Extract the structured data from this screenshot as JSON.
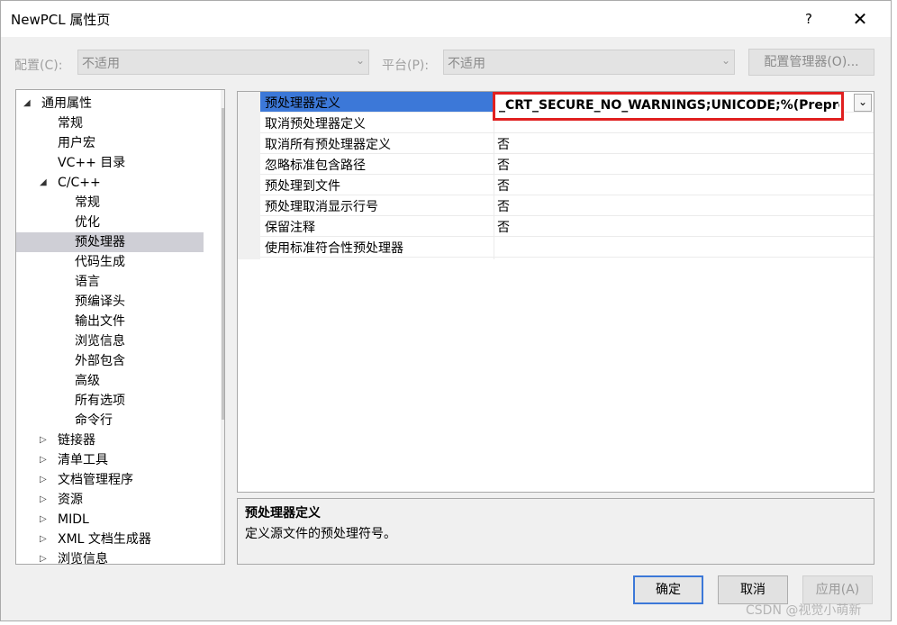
{
  "window": {
    "title": "NewPCL 属性页",
    "help_label": "?",
    "close_label": "✕"
  },
  "toolbar": {
    "config_label": "配置(C):",
    "config_value": "不适用",
    "platform_label": "平台(P):",
    "platform_value": "不适用",
    "manager_button": "配置管理器(O)..."
  },
  "tree": {
    "items": [
      {
        "label": "通用属性",
        "expander": "◢"
      },
      {
        "label": "常规"
      },
      {
        "label": "用户宏"
      },
      {
        "label": "VC++ 目录"
      },
      {
        "label": "C/C++",
        "expander": "◢"
      },
      {
        "label": "常规"
      },
      {
        "label": "优化"
      },
      {
        "label": "预处理器"
      },
      {
        "label": "代码生成"
      },
      {
        "label": "语言"
      },
      {
        "label": "预编译头"
      },
      {
        "label": "输出文件"
      },
      {
        "label": "浏览信息"
      },
      {
        "label": "外部包含"
      },
      {
        "label": "高级"
      },
      {
        "label": "所有选项"
      },
      {
        "label": "命令行"
      },
      {
        "label": "链接器",
        "expander": "▷"
      },
      {
        "label": "清单工具",
        "expander": "▷"
      },
      {
        "label": "文档管理程序",
        "expander": "▷"
      },
      {
        "label": "资源",
        "expander": "▷"
      },
      {
        "label": "MIDL",
        "expander": "▷"
      },
      {
        "label": "XML 文档生成器",
        "expander": "▷"
      },
      {
        "label": "浏览信息",
        "expander": "▷"
      }
    ],
    "scroll_up": "⌃",
    "scroll_down": "⌄"
  },
  "properties": {
    "rows": [
      {
        "name": "预处理器定义",
        "value": "_CRT_SECURE_NO_WARNINGS;UNICODE;%(Preprocessor"
      },
      {
        "name": "取消预处理器定义",
        "value": ""
      },
      {
        "name": "取消所有预处理器定义",
        "value": "否"
      },
      {
        "name": "忽略标准包含路径",
        "value": "否"
      },
      {
        "name": "预处理到文件",
        "value": "否"
      },
      {
        "name": "预处理取消显示行号",
        "value": "否"
      },
      {
        "name": "保留注释",
        "value": "否"
      },
      {
        "name": "使用标准符合性预处理器",
        "value": ""
      }
    ],
    "dropdown_arrow": "⌄",
    "highlight_color": "#e02020"
  },
  "description": {
    "title": "预处理器定义",
    "text": "定义源文件的预处理符号。"
  },
  "buttons": {
    "ok": "确定",
    "cancel": "取消",
    "apply": "应用(A)"
  },
  "watermark": "CSDN @视觉小萌新"
}
